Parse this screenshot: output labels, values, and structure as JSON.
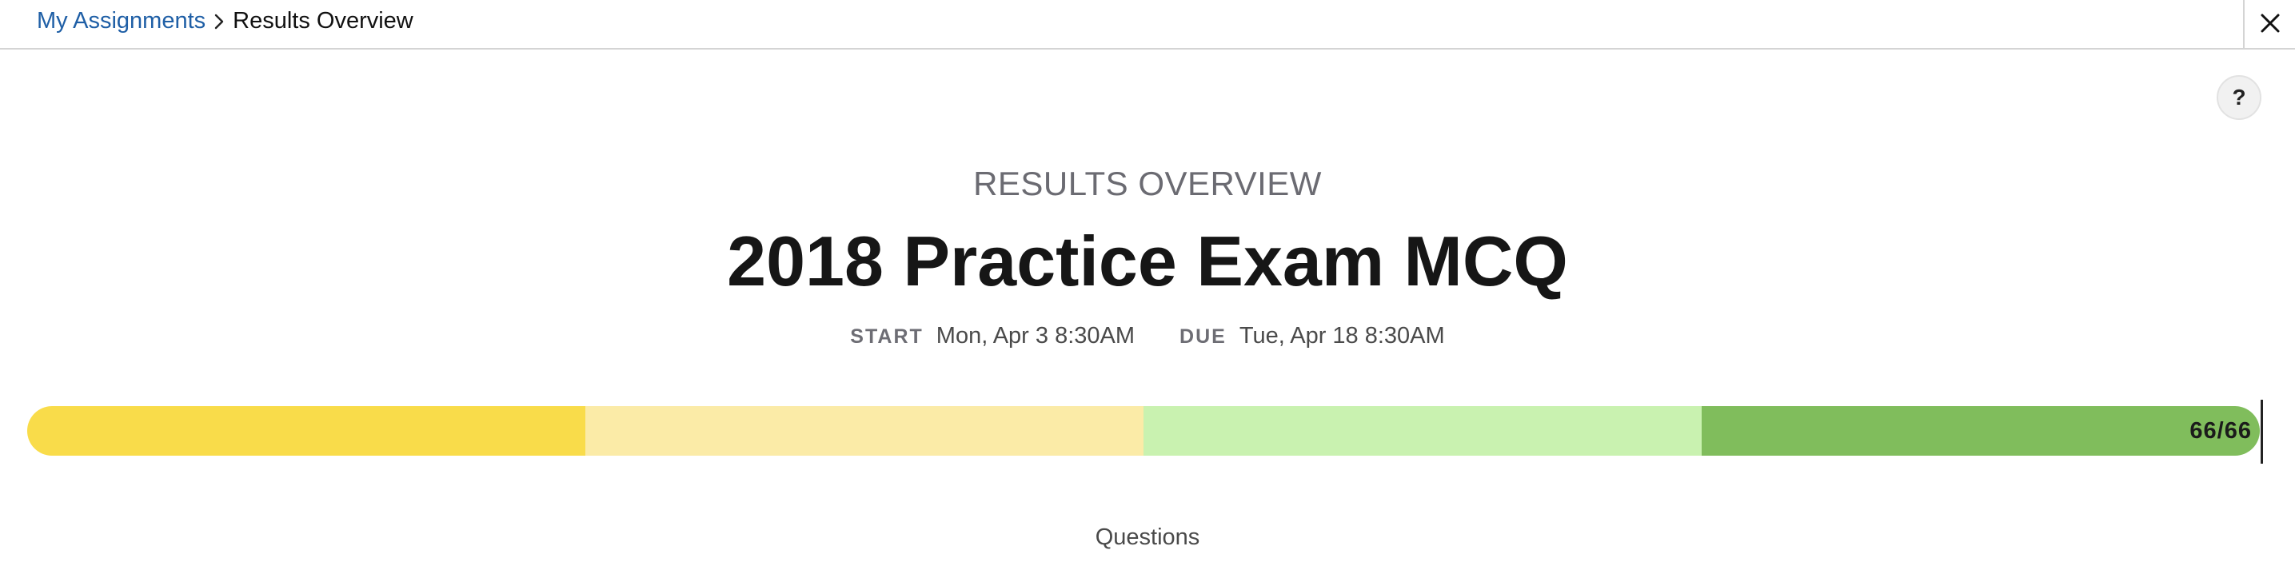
{
  "breadcrumb": {
    "parent_label": "My Assignments",
    "current_label": "Results Overview"
  },
  "icons": {
    "separator": "chevron-right-icon",
    "close": "close-icon",
    "help": "help-icon"
  },
  "help": {
    "label": "?"
  },
  "header": {
    "overview_label": "RESULTS OVERVIEW",
    "title": "2018 Practice Exam MCQ"
  },
  "dates": {
    "start_key": "START",
    "start_value": "Mon, Apr 3 8:30AM",
    "due_key": "DUE",
    "due_value": "Tue, Apr 18 8:30AM"
  },
  "progress": {
    "count_text": "66/66",
    "completed": 66,
    "total": 66,
    "segments": [
      {
        "share": 0.25,
        "color": "#f9dc4a"
      },
      {
        "share": 0.25,
        "color": "#fbeba7"
      },
      {
        "share": 0.25,
        "color": "#c9f2b0"
      },
      {
        "share": 0.25,
        "color": "#80bd5c"
      }
    ]
  },
  "section": {
    "questions_label": "Questions"
  },
  "colors": {
    "link": "#1f5fa6",
    "divider": "#d4d4d4"
  }
}
